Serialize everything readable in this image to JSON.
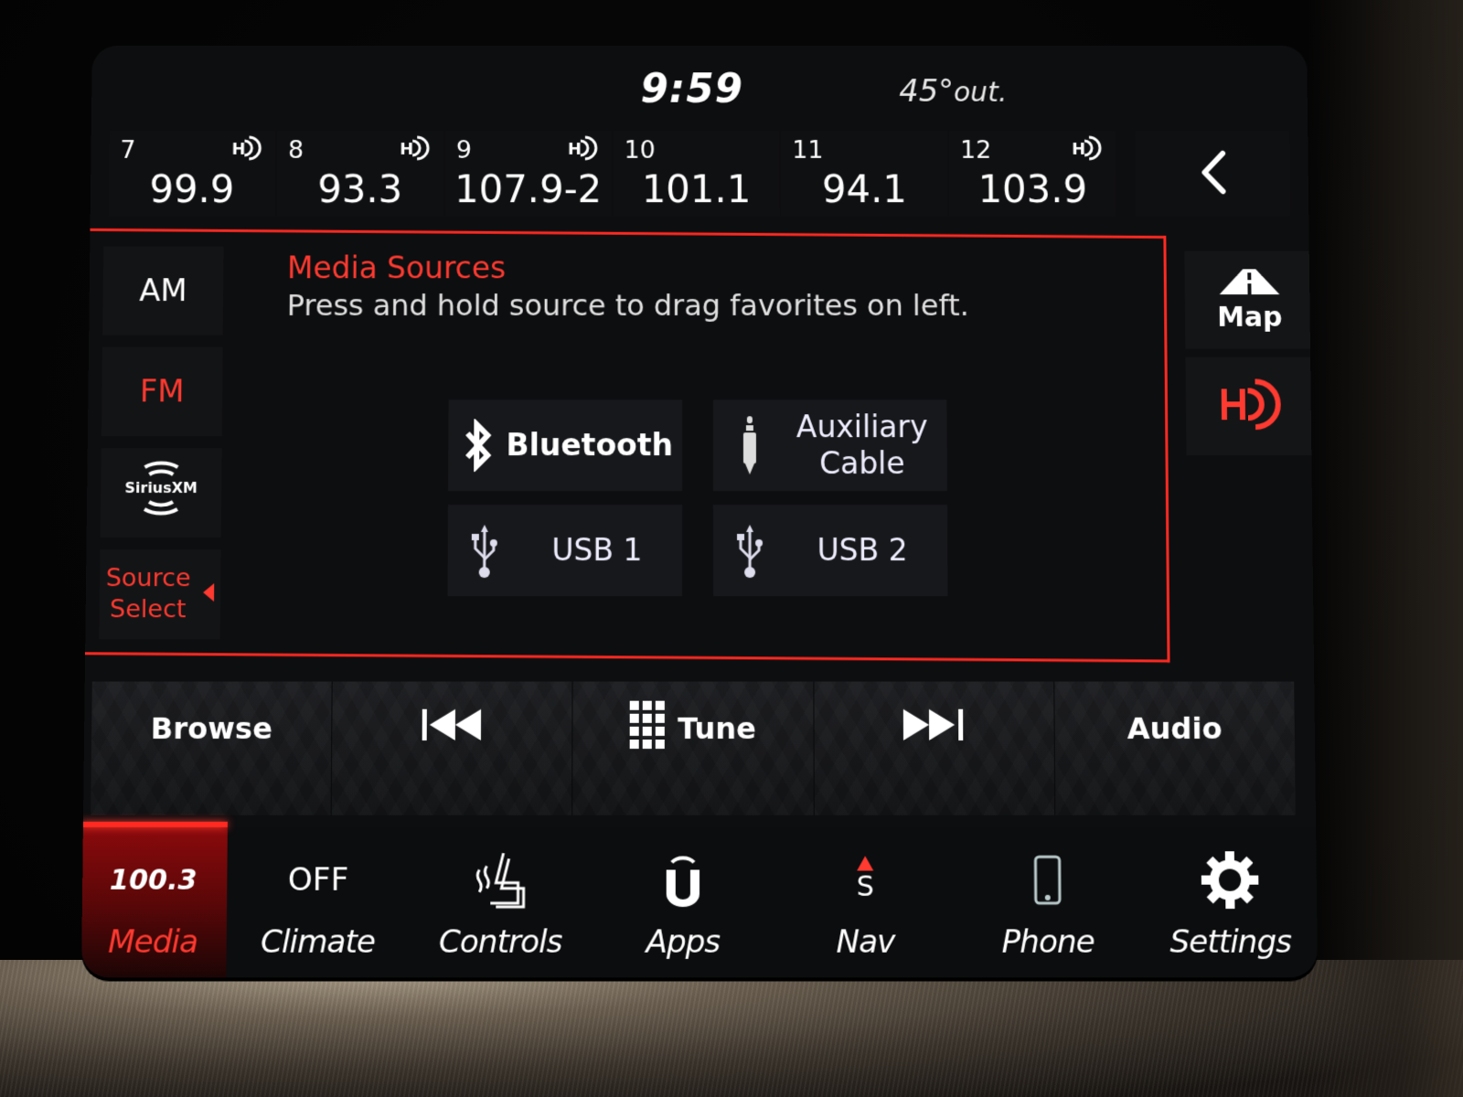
{
  "status_bar": {
    "time": "9:59",
    "temperature": "45°",
    "temperature_suffix": "out."
  },
  "presets": [
    {
      "number": "7",
      "frequency": "99.9",
      "hd": true
    },
    {
      "number": "8",
      "frequency": "93.3",
      "hd": true
    },
    {
      "number": "9",
      "frequency": "107.9-2",
      "hd": true
    },
    {
      "number": "10",
      "frequency": "101.1",
      "hd": false
    },
    {
      "number": "11",
      "frequency": "94.1",
      "hd": false
    },
    {
      "number": "12",
      "frequency": "103.9",
      "hd": true
    }
  ],
  "back_icon": "chevron-left-icon",
  "sources_sidebar": {
    "am_label": "AM",
    "fm_label": "FM",
    "siriusxm_label": "SiriusXM",
    "source_select_line1": "Source",
    "source_select_line2": "Select"
  },
  "media_panel": {
    "title": "Media Sources",
    "subtitle": "Press and hold source to drag favorites on left.",
    "sources": [
      {
        "label": "Bluetooth",
        "icon": "bluetooth-icon"
      },
      {
        "label_line1": "Auxiliary",
        "label_line2": "Cable",
        "icon": "aux-jack-icon"
      },
      {
        "label": "USB 1",
        "icon": "usb-icon"
      },
      {
        "label": "USB 2",
        "icon": "usb-icon"
      }
    ]
  },
  "right_column": {
    "map_label": "Map",
    "hd_icon": "hd-radio-icon"
  },
  "transport": {
    "browse": "Browse",
    "tune": "Tune",
    "audio": "Audio"
  },
  "bottom_nav": [
    {
      "top": "100.3",
      "label": "Media",
      "active": true
    },
    {
      "top": "OFF",
      "label": "Climate"
    },
    {
      "label": "Controls",
      "icon": "heated-seat-icon"
    },
    {
      "label": "Apps",
      "icon": "uconnect-icon"
    },
    {
      "top": "S",
      "label": "Nav",
      "icon": "compass-icon"
    },
    {
      "label": "Phone",
      "icon": "phone-icon"
    },
    {
      "label": "Settings",
      "icon": "gear-icon"
    }
  ],
  "colors": {
    "accent_red": "#ff3a30",
    "panel_border": "#ff2a22",
    "background": "#0d0e10"
  }
}
